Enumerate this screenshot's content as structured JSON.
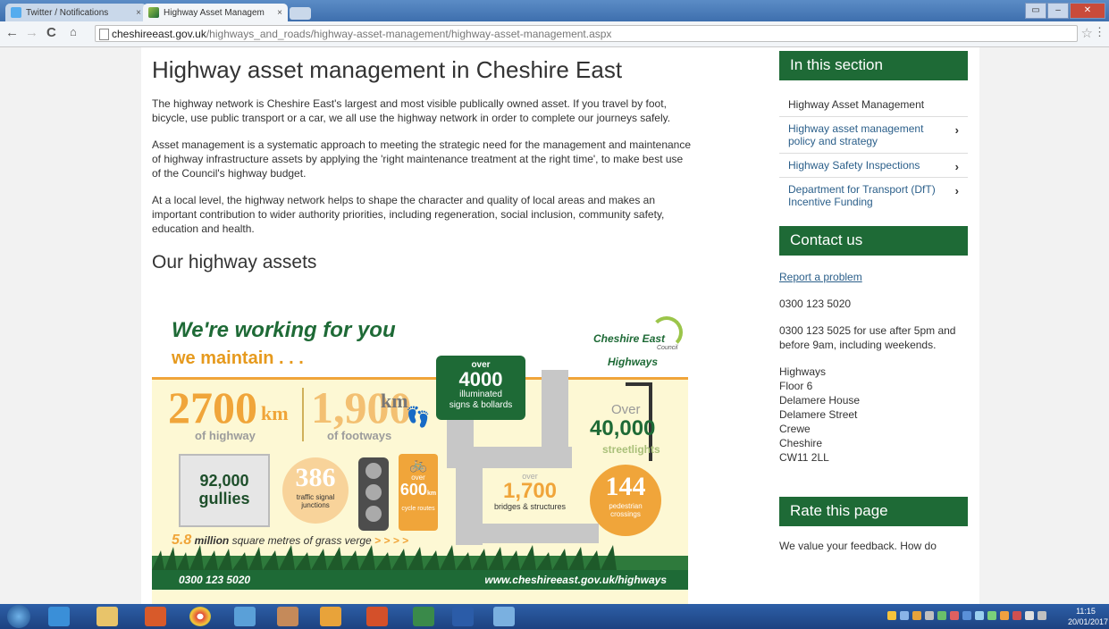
{
  "browser": {
    "tabs": [
      {
        "title": "Twitter / Notifications",
        "active": false
      },
      {
        "title": "Highway Asset Managem",
        "active": true
      }
    ],
    "url_domain": "cheshireeast.gov.uk",
    "url_path": "/highways_and_roads/highway-asset-management/highway-asset-management.aspx"
  },
  "main": {
    "title": "Highway asset management in Cheshire East",
    "paragraphs": [
      "The highway network is Cheshire East's largest and most visible publically owned asset. If you travel by foot, bicycle, use public transport or a car, we all use the highway network in order to complete our journeys safely.",
      "Asset management is a systematic approach to meeting the strategic need for the management and maintenance of highway infrastructure assets by applying the 'right maintenance treatment at the right time', to make best use of the Council's highway budget.",
      "At a local level, the highway network helps to shape the character and quality of local areas and makes an important contribution to wider authority priorities, including regeneration, social inclusion, community safety, education and health."
    ],
    "subtitle": "Our highway assets"
  },
  "infographic": {
    "headline": "We're working for you",
    "subheadline": "we maintain . . .",
    "logo_line1": "Cheshire East",
    "logo_line2": "Council",
    "logo_line3": "Highways",
    "highway_num": "2700",
    "highway_unit": "km",
    "highway_label": "of highway",
    "footway_num": "1,900",
    "footway_unit": "km",
    "footway_label": "of footways",
    "signs_over": "over",
    "signs_num": "4000",
    "signs_label1": "illuminated",
    "signs_label2": "signs & bollards",
    "streetlights_over": "Over",
    "streetlights_num": "40,000",
    "streetlights_label": "streetlights",
    "gullies_num": "92,000",
    "gullies_label": "gullies",
    "signals_num": "386",
    "signals_label1": "traffic signal",
    "signals_label2": "junctions",
    "cycle_over": "over",
    "cycle_num": "600",
    "cycle_unit": "km",
    "cycle_label": "cycle routes",
    "bridges_over": "over",
    "bridges_num": "1,700",
    "bridges_label": "bridges & structures",
    "crossings_num": "144",
    "crossings_label1": "pedestrian",
    "crossings_label2": "crossings",
    "grass_num": "5.8",
    "grass_bold": "million",
    "grass_text": "square metres of grass verge",
    "grass_arrows": "> > > >",
    "footer_phone": "0300 123 5020",
    "footer_url": "www.cheshireeast.gov.uk/highways"
  },
  "sidebar": {
    "section_title": "In this section",
    "items": [
      {
        "label": "Highway Asset Management",
        "link": false
      },
      {
        "label": "Highway asset management policy and strategy",
        "link": true
      },
      {
        "label": "Highway Safety Inspections",
        "link": true
      },
      {
        "label": "Department for Transport (DfT) Incentive Funding",
        "link": true
      }
    ],
    "contact_title": "Contact us",
    "report_link": "Report a problem",
    "phone1": "0300 123 5020",
    "phone2": "0300 123 5025 for use after 5pm and before 9am, including weekends.",
    "address": [
      "Highways",
      "Floor 6",
      "Delamere House",
      "Delamere Street",
      "Crewe",
      "Cheshire",
      "CW11 2LL"
    ],
    "rate_title": "Rate this page",
    "rate_text": "We value your feedback. How do"
  },
  "taskbar": {
    "time": "11:15",
    "date": "20/01/2017"
  },
  "colors": {
    "brand_green": "#1e6a36",
    "accent_orange": "#f0a53a",
    "link_blue": "#2b5f8a"
  }
}
